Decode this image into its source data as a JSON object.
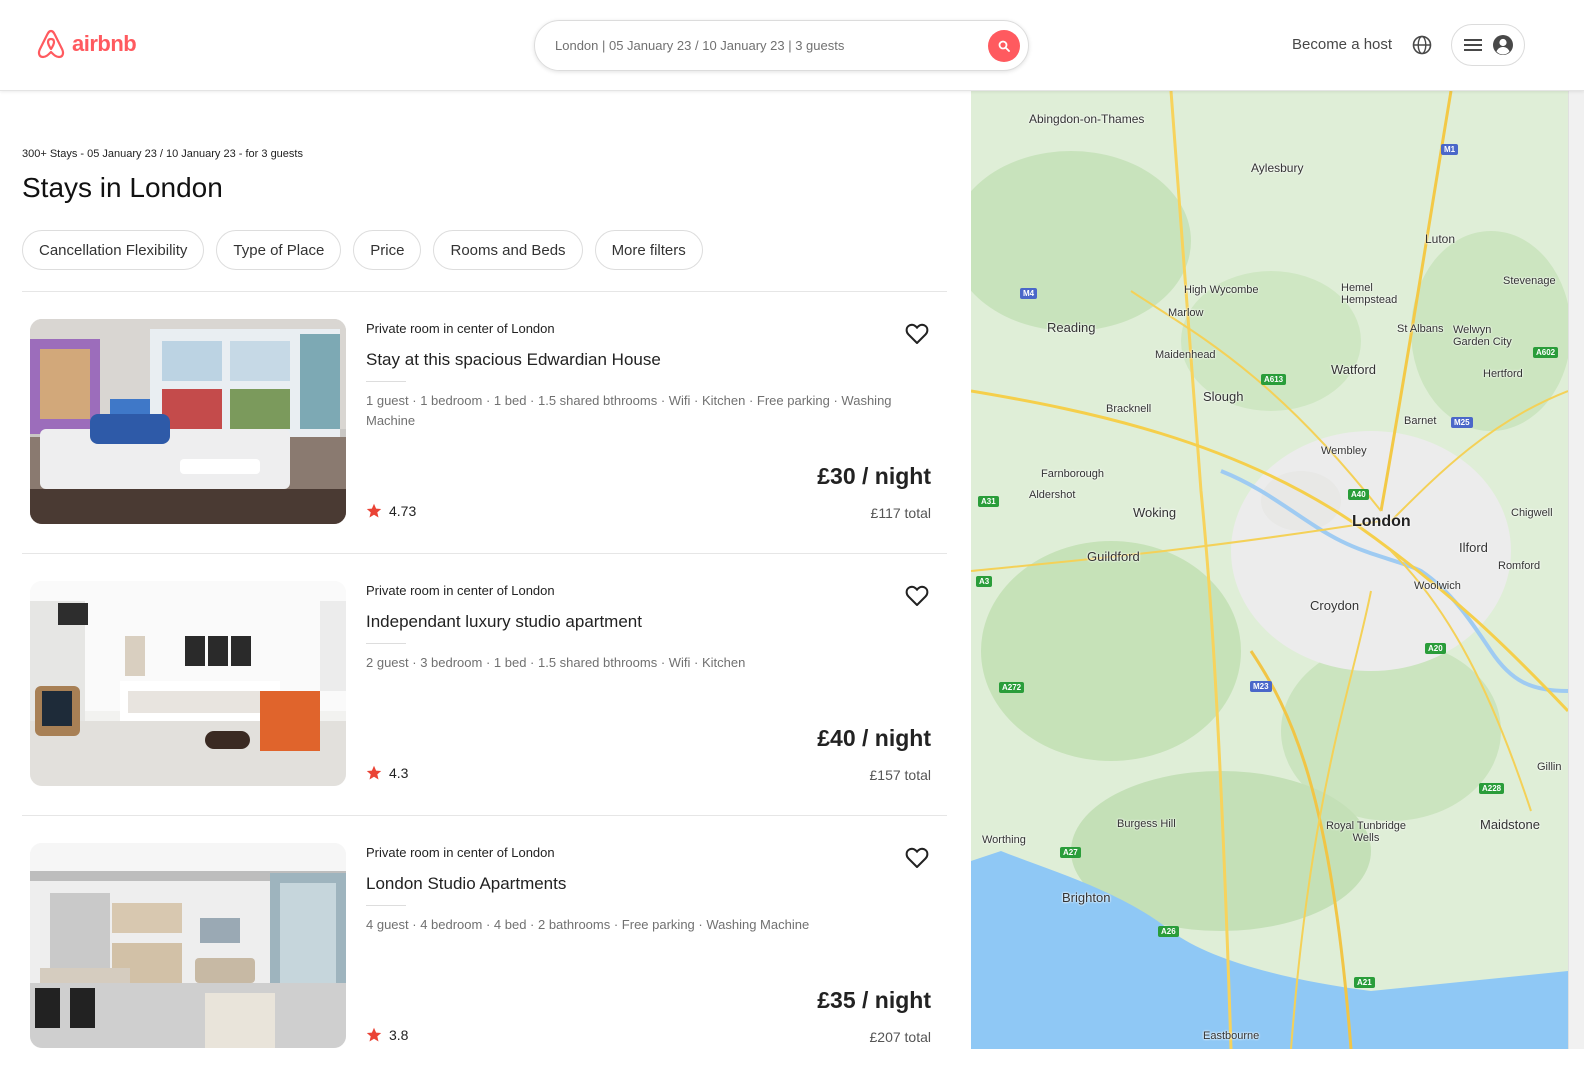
{
  "header": {
    "brand": "airbnb",
    "search_text": "London | 05 January 23 / 10 January 23 | 3 guests",
    "become_host": "Become a host"
  },
  "results": {
    "summary": "300+ Stays - 05 January 23 / 10 January 23 - for 3 guests",
    "title": "Stays in London"
  },
  "filters": [
    "Cancellation Flexibility",
    "Type of Place",
    "Price",
    "Rooms and Beds",
    "More filters"
  ],
  "listings": [
    {
      "subtitle": "Private room in center of London",
      "title": "Stay at this spacious Edwardian House",
      "amenities": "1 guest · 1 bedroom · 1 bed · 1.5 shared bthrooms · Wifi · Kitchen · Free parking · Washing Machine",
      "rating": "4.73",
      "price": "£30 / night",
      "total": "£117 total"
    },
    {
      "subtitle": "Private room in center of London",
      "title": "Independant luxury studio apartment",
      "amenities": "2 guest · 3 bedroom · 1 bed · 1.5 shared bthrooms · Wifi · Kitchen",
      "rating": "4.3",
      "price": "£40 / night",
      "total": "£157 total"
    },
    {
      "subtitle": "Private room in center of London",
      "title": "London Studio Apartments",
      "amenities": "4 guest · 4 bedroom · 4 bed · 2 bathrooms · Free parking · Washing Machine",
      "rating": "3.8",
      "price": "£35 / night",
      "total": "£207 total"
    }
  ],
  "map": {
    "places": [
      "Abingdon-on-Thames",
      "Aylesbury",
      "Luton",
      "Stevenage",
      "High Wycombe",
      "Hemel Hempstead",
      "Marlow",
      "St Albans",
      "Welwyn Garden City",
      "Reading",
      "Maidenhead",
      "Watford",
      "Hertford",
      "Bracknell",
      "Slough",
      "Barnet",
      "Wembley",
      "Farnborough",
      "Aldershot",
      "Woking",
      "London",
      "Chigwell",
      "Guildford",
      "Ilford",
      "Romford",
      "Woolwich",
      "Croydon",
      "Gillin",
      "Burgess Hill",
      "Royal Tunbridge Wells",
      "Maidstone",
      "Worthing",
      "Brighton",
      "Eastbourne"
    ],
    "roads": [
      "M1",
      "M4",
      "A613",
      "M25",
      "A602",
      "A40",
      "A31",
      "A3",
      "A20",
      "A272",
      "M23",
      "A228",
      "A27",
      "A26",
      "A21"
    ]
  }
}
